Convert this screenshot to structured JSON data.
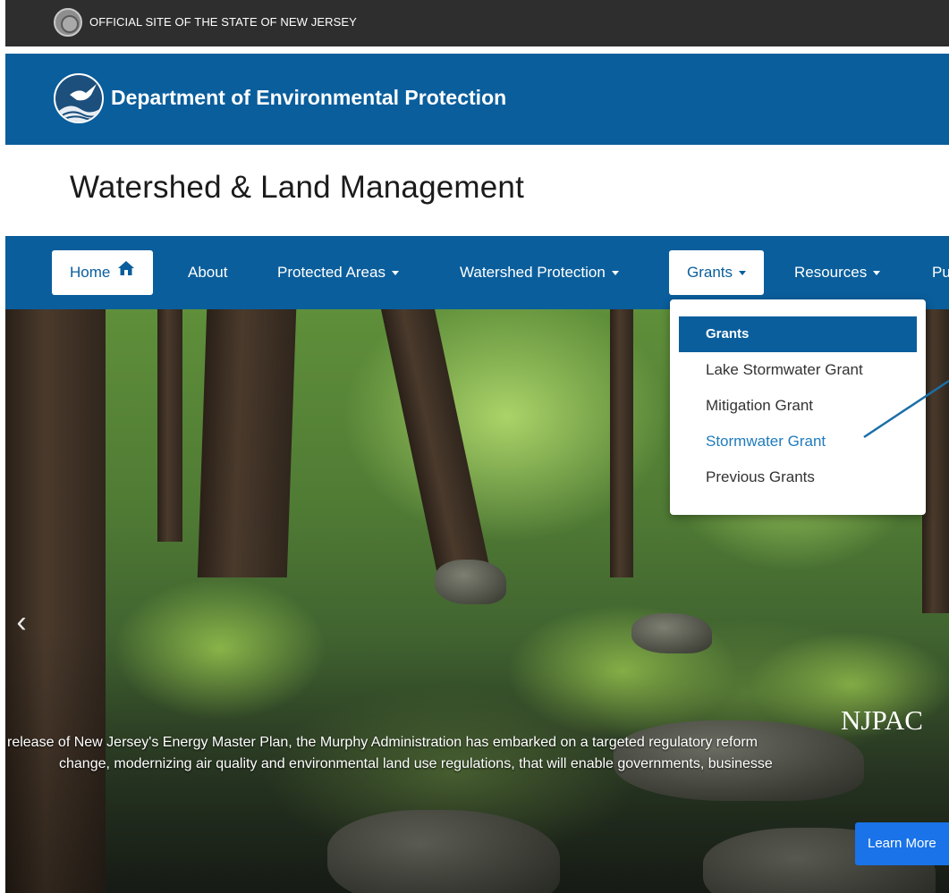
{
  "official_bar": {
    "text": "OFFICIAL SITE OF THE STATE OF NEW JERSEY"
  },
  "department": {
    "title": "Department of Environmental Protection"
  },
  "page": {
    "title": "Watershed & Land Management"
  },
  "nav": {
    "home": "Home",
    "about": "About",
    "protected_areas": "Protected Areas",
    "watershed_protection": "Watershed Protection",
    "grants": "Grants",
    "resources": "Resources",
    "partial": "Pu"
  },
  "grants_menu": {
    "items": [
      "Grants",
      "Lake Stormwater Grant",
      "Mitigation Grant",
      "Stormwater Grant",
      "Previous Grants"
    ]
  },
  "hero": {
    "heading": "NJPAC",
    "line_1": "release of New Jersey's Energy Master Plan, the Murphy Administration has embarked on a targeted regulatory reform",
    "line_2": "change, modernizing air quality and environmental land use regulations, that will enable governments, businesse",
    "learn_more": "Learn More",
    "prev_glyph": "‹"
  },
  "colors": {
    "brand_blue": "#0a5e9c",
    "top_bar": "#2e2e2e",
    "link_blue": "#1f7bbd",
    "button_blue": "#1a73e8"
  }
}
